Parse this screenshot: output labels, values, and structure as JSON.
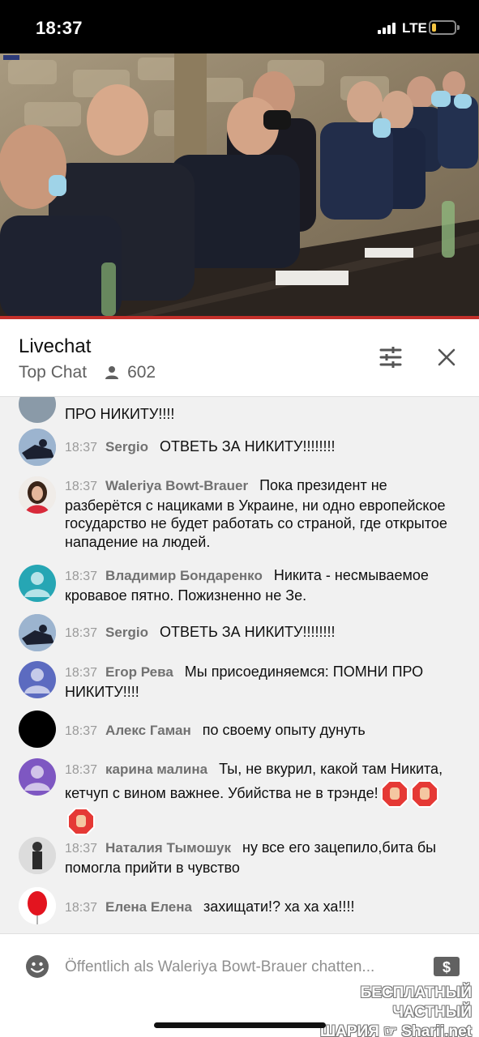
{
  "status_bar": {
    "time": "18:37",
    "network": "LTE"
  },
  "chat_header": {
    "title": "Livechat",
    "mode": "Top Chat",
    "viewers": "602"
  },
  "messages": [
    {
      "time": "",
      "author": "",
      "text": "ПРО НИКИТУ!!!!"
    },
    {
      "time": "18:37",
      "author": "Sergio",
      "text": "ОТВЕТЬ ЗА НИКИТУ!!!!!!!!"
    },
    {
      "time": "18:37",
      "author": "Waleriya Bowt-Brauer",
      "text": "Пока президент не разберётся с нациками в Украине, ни одно европейское государство не будет работать со страной, где открытое нападение на людей."
    },
    {
      "time": "18:37",
      "author": "Владимир Бондаренко",
      "text": "Никита - несмываемое кровавое пятно. Пожизненно не Зе."
    },
    {
      "time": "18:37",
      "author": "Sergio",
      "text": "ОТВЕТЬ ЗА НИКИТУ!!!!!!!!"
    },
    {
      "time": "18:37",
      "author": "Егор Рева",
      "text": "Мы присоединяемся: ПОМНИ ПРО НИКИТУ!!!!"
    },
    {
      "time": "18:37",
      "author": "Алекс Гаман",
      "text": "по своему опыту дунуть"
    },
    {
      "time": "18:37",
      "author": "карина малина",
      "text": "Ты, не вкурил, какой там Никита, кетчуп с вином важнее. Убийства не в трэнде!"
    },
    {
      "time": "18:37",
      "author": "Наталия Тымошук",
      "text": "ну все его зацепило,бита бы помогла прийти в чувство"
    },
    {
      "time": "18:37",
      "author": "Елена Елена",
      "text": "захищати!? ха ха ха!!!!"
    }
  ],
  "composer": {
    "placeholder": "Öffentlich als Waleriya Bowt-Brauer chatten..."
  },
  "watermark": {
    "line1": "БЕСПЛАТНЫЙ ЧАСТНЫЙ",
    "line2": "ШАРИЯ ☞ Sharij.net"
  },
  "colors": {
    "accent_red": "#c4302b",
    "text_secondary": "#717171"
  },
  "icons": [
    "person-icon",
    "filter-icon",
    "close-icon",
    "emoji-icon",
    "money-icon",
    "stop-hand-emoji"
  ]
}
